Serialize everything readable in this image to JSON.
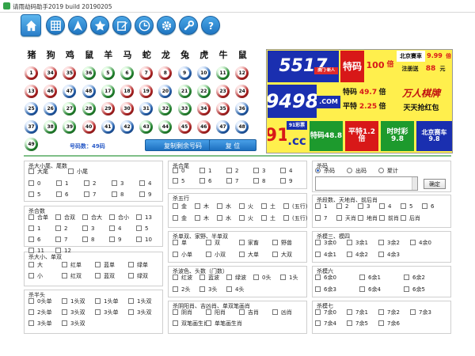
{
  "window": {
    "title": "请雨劫码助手2019 build 20190205"
  },
  "toolbar": {
    "icons": [
      "home-icon",
      "grid-icon",
      "navigation-icon",
      "star-icon",
      "edit-icon",
      "clock-icon",
      "gear-icon",
      "wrench-icon",
      "help-icon"
    ]
  },
  "zodiacs": [
    "猪",
    "狗",
    "鸡",
    "鼠",
    "羊",
    "马",
    "蛇",
    "龙",
    "兔",
    "虎",
    "牛",
    "鼠"
  ],
  "balls": [
    {
      "n": "1",
      "c": "red"
    },
    {
      "n": "34",
      "c": "red"
    },
    {
      "n": "35",
      "c": "red"
    },
    {
      "n": "36",
      "c": "green"
    },
    {
      "n": "5",
      "c": "green"
    },
    {
      "n": "6",
      "c": "green"
    },
    {
      "n": "7",
      "c": "red"
    },
    {
      "n": "8",
      "c": "red"
    },
    {
      "n": "9",
      "c": "blue"
    },
    {
      "n": "10",
      "c": "blue"
    },
    {
      "n": "11",
      "c": "green"
    },
    {
      "n": "12",
      "c": "red"
    },
    {
      "n": "13",
      "c": "red"
    },
    {
      "n": "46",
      "c": "red"
    },
    {
      "n": "47",
      "c": "blue"
    },
    {
      "n": "48",
      "c": "blue"
    },
    {
      "n": "17",
      "c": "green"
    },
    {
      "n": "18",
      "c": "red"
    },
    {
      "n": "19",
      "c": "red"
    },
    {
      "n": "20",
      "c": "blue"
    },
    {
      "n": "21",
      "c": "green"
    },
    {
      "n": "22",
      "c": "green"
    },
    {
      "n": "23",
      "c": "red"
    },
    {
      "n": "24",
      "c": "red"
    },
    {
      "n": "25",
      "c": "blue"
    },
    {
      "n": "26",
      "c": "blue"
    },
    {
      "n": "27",
      "c": "green"
    },
    {
      "n": "28",
      "c": "green"
    },
    {
      "n": "29",
      "c": "red"
    },
    {
      "n": "30",
      "c": "red"
    },
    {
      "n": "31",
      "c": "blue"
    },
    {
      "n": "32",
      "c": "green"
    },
    {
      "n": "33",
      "c": "green"
    },
    {
      "n": "34",
      "c": "red"
    },
    {
      "n": "35",
      "c": "red"
    },
    {
      "n": "36",
      "c": "blue"
    },
    {
      "n": "37",
      "c": "blue"
    },
    {
      "n": "38",
      "c": "green"
    },
    {
      "n": "39",
      "c": "green"
    },
    {
      "n": "40",
      "c": "red"
    },
    {
      "n": "41",
      "c": "blue"
    },
    {
      "n": "42",
      "c": "blue"
    },
    {
      "n": "43",
      "c": "green"
    },
    {
      "n": "44",
      "c": "green"
    },
    {
      "n": "45",
      "c": "red"
    },
    {
      "n": "46",
      "c": "red"
    },
    {
      "n": "47",
      "c": "blue"
    },
    {
      "n": "48",
      "c": "blue"
    },
    {
      "n": "49",
      "c": "green"
    }
  ],
  "count_label": "号码数：49码",
  "buttons": {
    "copy": "复制剩余号码",
    "reset": "复    位",
    "confirm": "确定"
  },
  "ad": {
    "num1": "5517",
    "tag1": "澳门·新人",
    "tema": "特码",
    "tema_num": "100",
    "bei": "倍",
    "bj": "北京賽車",
    "bj_rate": "9.99",
    "bj_bei": "倍",
    "zhuce": "注册送",
    "zhuce_amt": "88",
    "yuan": "元",
    "site": "9498",
    "dotcom": ".COM",
    "tema2": "特码",
    "tema2_rate": "49.7",
    "bei2": "倍",
    "pingte": "平特",
    "pingte_rate": "2.25",
    "bei3": "倍",
    "wanren": "万人棋牌",
    "tiantian": "天天抢红包",
    "num91": "91",
    "cc": ".cc",
    "cc_tag": "91彩票",
    "p1": "特码48.8",
    "p2": "平特1.2倍",
    "p3": "时时彩9.8",
    "p4": "北京赛车9.8"
  },
  "groups": {
    "g1": {
      "title": "杀大小尾、尾数",
      "items": [
        "大尾",
        "小尾",
        "0",
        "1",
        "2",
        "3",
        "4",
        "5",
        "6",
        "7",
        "8",
        "9"
      ]
    },
    "g2": {
      "title": "杀合数",
      "items": [
        "合单",
        "合双",
        "合大",
        "合小",
        "13",
        "1",
        "2",
        "3",
        "4",
        "5",
        "6",
        "7",
        "8",
        "9",
        "10",
        "11",
        "12"
      ]
    },
    "g3": {
      "title": "杀大小、单双",
      "items": [
        "大",
        "红单",
        "蓝单",
        "绿单",
        "小",
        "红双",
        "蓝双",
        "绿双"
      ]
    },
    "g4": {
      "title": "杀半头",
      "items": [
        "0头单",
        "1头双",
        "1头单",
        "1头双",
        "2头单",
        "3头双",
        "3头单",
        "3头双",
        "3头单",
        "3头双"
      ]
    },
    "g5": {
      "title": "杀合尾",
      "items": [
        "0",
        "1",
        "2",
        "3",
        "4",
        "5",
        "6",
        "7",
        "8",
        "9"
      ]
    },
    "g6": {
      "title": "杀五行",
      "items": [
        "金",
        "木",
        "水",
        "火",
        "土",
        "(五行)",
        "金",
        "木",
        "水",
        "火",
        "土",
        "(五行)"
      ]
    },
    "g7": {
      "title": "杀单双、家野、半单双",
      "items": [
        "单",
        "双",
        "家畜",
        "野兽",
        "小单",
        "小双",
        "大单",
        "大双"
      ]
    },
    "g8": {
      "title": "杀波色、头数（门数）",
      "items": [
        "红波",
        "蓝波",
        "绿波",
        "0头",
        "1头",
        "2头",
        "3头",
        "4头"
      ]
    },
    "g9": {
      "title": "杀阴阳肖、吉凶肖、单双笔画肖",
      "items": [
        "阴肖",
        "阳肖",
        "吉肖",
        "凶肖",
        "双笔画生肖",
        "单笔画生肖"
      ]
    },
    "g10": {
      "title": "杀码",
      "radios": [
        "杀码",
        "出码",
        "聚计"
      ]
    },
    "g11": {
      "title": "杀段数、天地肖、前后肖",
      "items": [
        "1",
        "2",
        "3",
        "4",
        "5",
        "6",
        "7",
        "天肖",
        "地肖",
        "前肖",
        "后肖"
      ]
    },
    "g12": {
      "title": "杀模三、模四",
      "items": [
        "3余0",
        "3余1",
        "3余2",
        "4余0",
        "4余1",
        "4余2",
        "4余3"
      ]
    },
    "g13": {
      "title": "杀模六",
      "items": [
        "6余0",
        "6余1",
        "6余2",
        "6余3",
        "6余4",
        "6余5"
      ]
    },
    "g14": {
      "title": "杀模七",
      "items": [
        "7余0",
        "7余1",
        "7余2",
        "7余3",
        "7余4",
        "7余5",
        "7余6"
      ]
    }
  },
  "colors": {
    "ball_red": "#e63030",
    "ball_blue": "#2f7de0",
    "ball_green": "#31b041",
    "accent": "#1f76c2"
  }
}
